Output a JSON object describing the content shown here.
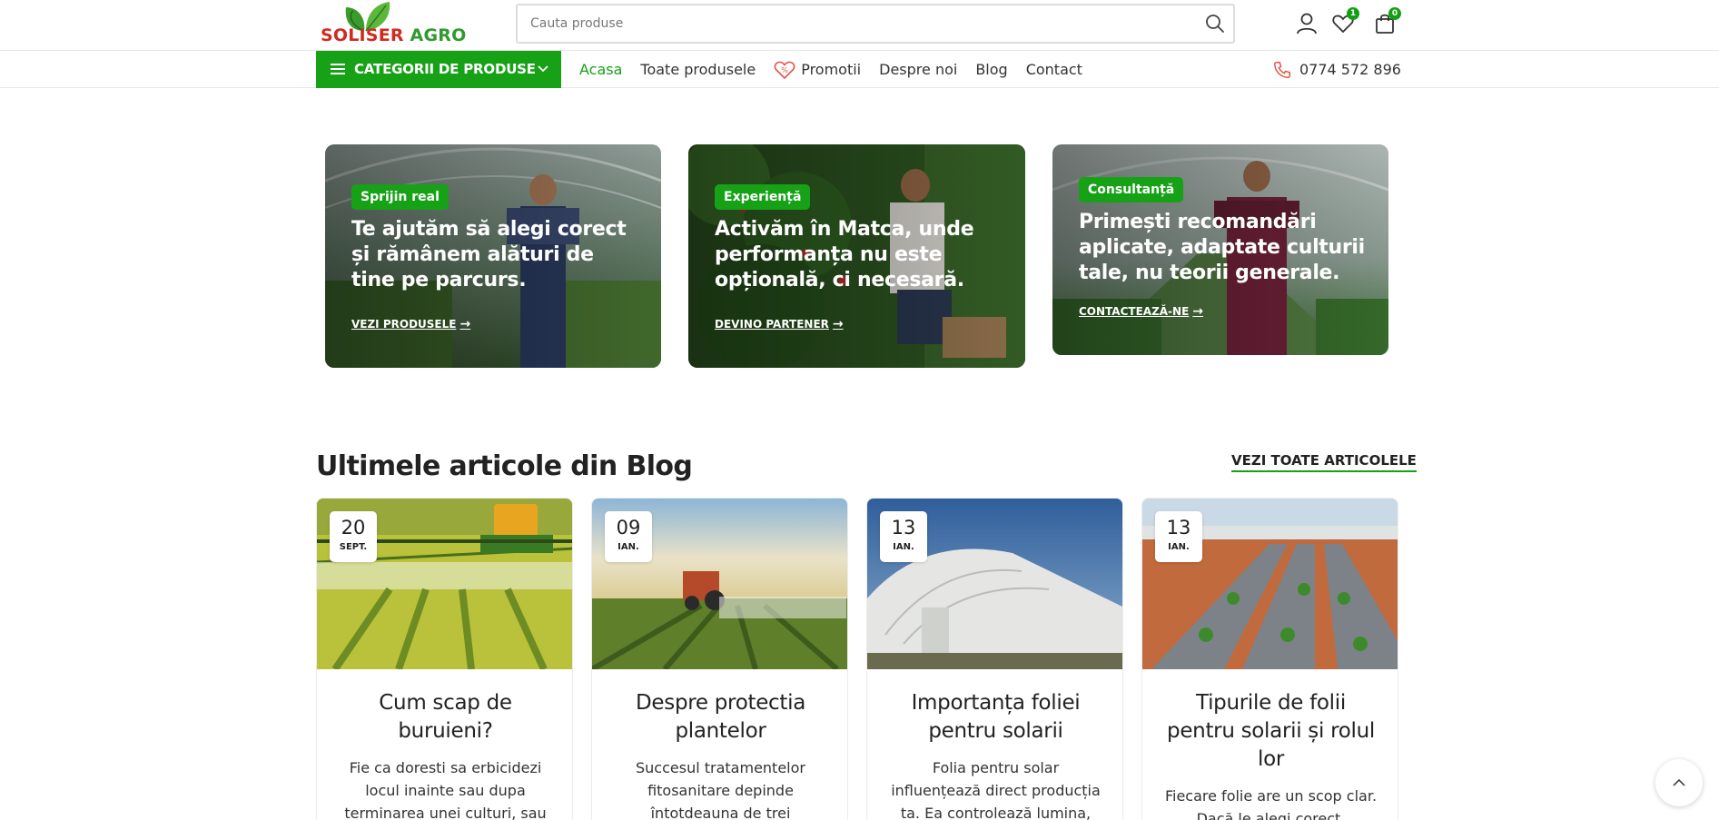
{
  "brand": {
    "word1": "SOLISER",
    "word2": "AGRO"
  },
  "search": {
    "placeholder": "Cauta produse"
  },
  "header": {
    "wishlist_count": "1",
    "cart_count": "0"
  },
  "nav": {
    "categories_label": "CATEGORII DE PRODUSE",
    "items": [
      "Acasa",
      "Toate produsele",
      "Promotii",
      "Despre noi",
      "Blog",
      "Contact"
    ],
    "phone": "0774 572 896"
  },
  "promos": [
    {
      "tag": "Sprijin real",
      "title": "Te ajutăm să alegi corect și rămânem alături de tine pe parcurs.",
      "link": "VEZI PRODUSELE"
    },
    {
      "tag": "Experiență",
      "title": "Activăm în Matca, unde performanța nu este opțională, ci necesară.",
      "link": "DEVINO PARTENER"
    },
    {
      "tag": "Consultanță",
      "title": "Primești recomandări aplicate, adaptate culturii tale, nu teorii generale.",
      "link": "CONTACTEAZĂ-NE"
    }
  ],
  "blog": {
    "heading": "Ultimele articole din Blog",
    "see_all": "VEZI TOATE ARTICOLELE",
    "posts": [
      {
        "day": "20",
        "month": "SEPT.",
        "title": "Cum scap de buruieni?",
        "excerpt": "Fie ca doresti sa erbicidezi locul inainte sau dupa terminarea unei culturi, sau"
      },
      {
        "day": "09",
        "month": "IAN.",
        "title": "Despre protectia plantelor",
        "excerpt": "Succesul tratamentelor fitosanitare depinde întotdeauna de trei"
      },
      {
        "day": "13",
        "month": "IAN.",
        "title": "Importanța foliei pentru solarii",
        "excerpt": "Folia pentru solar influențează direct producția ta. Ea controlează lumina,"
      },
      {
        "day": "13",
        "month": "IAN.",
        "title": "Tipurile de folii pentru solarii și rolul lor",
        "excerpt": "Fiecare folie are un scop clar. Dacă le alegi corect,"
      }
    ]
  },
  "colors": {
    "accent": "#17a117",
    "brand_red": "#cf2b1f",
    "brand_green": "#2f9a2f"
  }
}
